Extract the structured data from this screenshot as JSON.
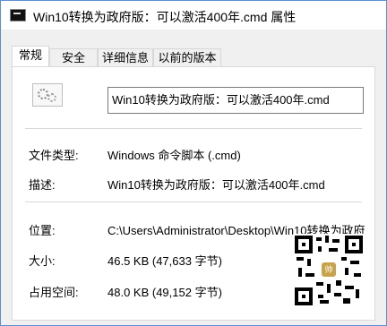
{
  "window": {
    "title": "Win10转换为政府版：可以激活400年.cmd 属性"
  },
  "tabs": [
    {
      "label": "常规",
      "active": true
    },
    {
      "label": "安全",
      "active": false
    },
    {
      "label": "详细信息",
      "active": false
    },
    {
      "label": "以前的版本",
      "active": false
    }
  ],
  "general": {
    "file_icon": "settings-file-icon",
    "file_name": "Win10转换为政府版：可以激活400年.cmd",
    "type_label": "文件类型:",
    "type_value": "Windows 命令脚本 (.cmd)",
    "desc_label": "描述:",
    "desc_value": "Win10转换为政府版：可以激活400年.cmd",
    "location_label": "位置:",
    "location_value": "C:\\Users\\Administrator\\Desktop\\Win10转换为政府",
    "size_label": "大小:",
    "size_value": "46.5 KB (47,633 字节)",
    "disk_label": "占用空间:",
    "disk_value": "48.0 KB (49,152 字节)"
  },
  "qr_logo_text": "帅"
}
